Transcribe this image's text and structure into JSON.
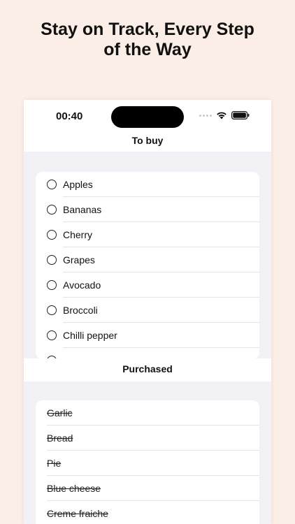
{
  "headline": {
    "line1": "Stay on Track, Every Step",
    "line2": "of the Way"
  },
  "status_bar": {
    "time": "00:40",
    "icons": [
      "signal-dots-icon",
      "wifi-icon",
      "battery-icon"
    ]
  },
  "nav": {
    "title": "To buy"
  },
  "to_buy": {
    "items": [
      "Apples",
      "Bananas",
      "Cherry",
      "Grapes",
      "Avocado",
      "Broccoli",
      "Chilli pepper"
    ]
  },
  "purchased": {
    "header": "Purchased",
    "items": [
      "Garlic",
      "Bread",
      "Pie",
      "Blue cheese",
      "Creme fraiche"
    ]
  },
  "colors": {
    "background": "#fbeee6",
    "list_background": "#f2f1f6",
    "card": "#ffffff"
  }
}
